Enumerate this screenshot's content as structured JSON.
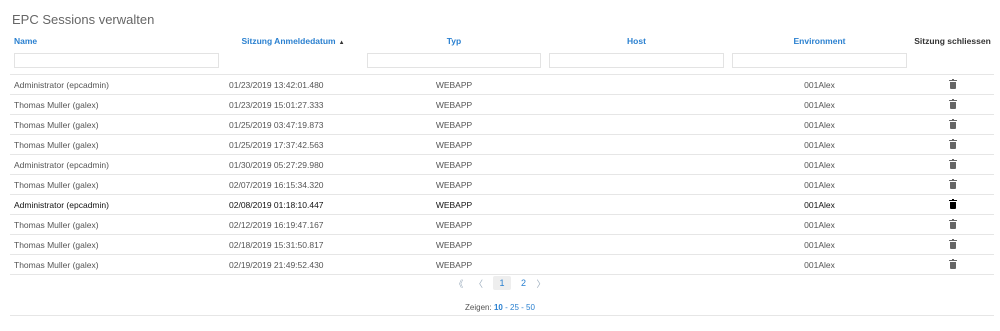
{
  "page": {
    "title": "EPC Sessions verwalten"
  },
  "columns": {
    "name": "Name",
    "date": "Sitzung Anmeldedatum",
    "type": "Typ",
    "host": "Host",
    "environment": "Environment",
    "close": "Sitzung schliessen"
  },
  "rows": [
    {
      "name": "Administrator (epcadmin)",
      "date": "01/23/2019 13:42:01.480",
      "type": "WEBAPP",
      "host": "",
      "environment": "001Alex"
    },
    {
      "name": "Thomas Muller (galex)",
      "date": "01/23/2019 15:01:27.333",
      "type": "WEBAPP",
      "host": "",
      "environment": "001Alex"
    },
    {
      "name": "Thomas Muller (galex)",
      "date": "01/25/2019 03:47:19.873",
      "type": "WEBAPP",
      "host": "",
      "environment": "001Alex"
    },
    {
      "name": "Thomas Muller (galex)",
      "date": "01/25/2019 17:37:42.563",
      "type": "WEBAPP",
      "host": "",
      "environment": "001Alex"
    },
    {
      "name": "Administrator (epcadmin)",
      "date": "01/30/2019 05:27:29.980",
      "type": "WEBAPP",
      "host": "",
      "environment": "001Alex"
    },
    {
      "name": "Thomas Muller (galex)",
      "date": "02/07/2019 16:15:34.320",
      "type": "WEBAPP",
      "host": "",
      "environment": "001Alex"
    },
    {
      "name": "Administrator (epcadmin)",
      "date": "02/08/2019 01:18:10.447",
      "type": "WEBAPP",
      "host": "",
      "environment": "001Alex"
    },
    {
      "name": "Thomas Muller (galex)",
      "date": "02/12/2019 16:19:47.167",
      "type": "WEBAPP",
      "host": "",
      "environment": "001Alex"
    },
    {
      "name": "Thomas Muller (galex)",
      "date": "02/18/2019 15:31:50.817",
      "type": "WEBAPP",
      "host": "",
      "environment": "001Alex"
    },
    {
      "name": "Thomas Muller (galex)",
      "date": "02/19/2019 21:49:52.430",
      "type": "WEBAPP",
      "host": "",
      "environment": "001Alex"
    }
  ],
  "pagination": {
    "first": "《",
    "prev": "〈",
    "current": "1",
    "page2": "2",
    "next": "〉"
  },
  "page_size": {
    "label": "Zeigen:",
    "options": [
      "10",
      "25",
      "50"
    ],
    "separator": "-"
  },
  "colors": {
    "accent": "#2a80d0",
    "text": "#555555"
  },
  "icons": {
    "sort": "sort-ascending-icon",
    "delete": "trash-icon"
  }
}
